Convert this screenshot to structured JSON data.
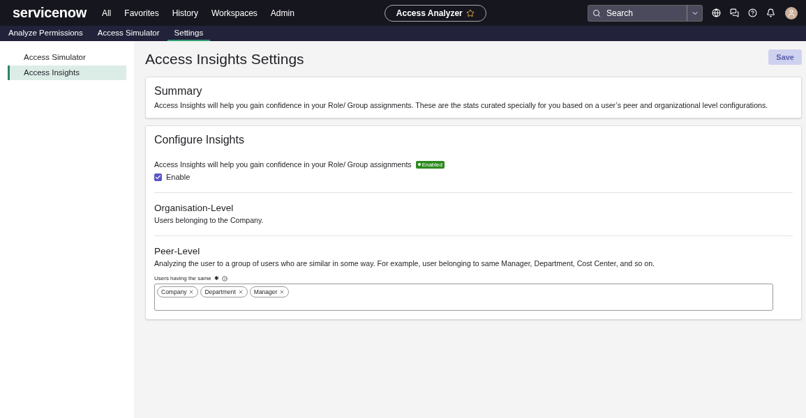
{
  "header": {
    "logo": "servicenow",
    "nav": [
      "All",
      "Favorites",
      "History",
      "Workspaces",
      "Admin"
    ],
    "app_pill": {
      "label": "Access Analyzer",
      "favorite": true
    },
    "search": {
      "placeholder": "Search"
    }
  },
  "subnav": [
    {
      "label": "Analyze Permissions",
      "selected": false
    },
    {
      "label": "Access Simulator",
      "selected": false
    },
    {
      "label": "Settings",
      "selected": true
    }
  ],
  "sidebar": {
    "items": [
      {
        "label": "Access Simulator",
        "selected": false
      },
      {
        "label": "Access Insights",
        "selected": true
      }
    ]
  },
  "page": {
    "title": "Access Insights Settings",
    "save_button": {
      "label": "Save",
      "disabled": true
    }
  },
  "summary": {
    "title": "Summary",
    "text": "Access Insights will help you gain confidence in your Role/ Group assignments. These are the stats curated specially for you based on a user’s peer and organizational level configurations."
  },
  "configure": {
    "title": "Configure Insights",
    "text": "Access Insights will help you gain confidence in your Role/ Group assignments",
    "status_badge": "Enabled",
    "enable": {
      "label": "Enable",
      "checked": true
    },
    "sections": [
      {
        "title": "Organisation-Level",
        "text": "Users belonging to the Company."
      },
      {
        "title": "Peer-Level",
        "text": "Analyzing the user to a group of users who are similar in some way. For example, user belonging to same Manager, Department, Cost Center, and so on.",
        "field": {
          "label": "Users having the same",
          "required_mark": "✱",
          "chips": [
            "Company",
            "Department",
            "Manager"
          ]
        }
      }
    ]
  }
}
